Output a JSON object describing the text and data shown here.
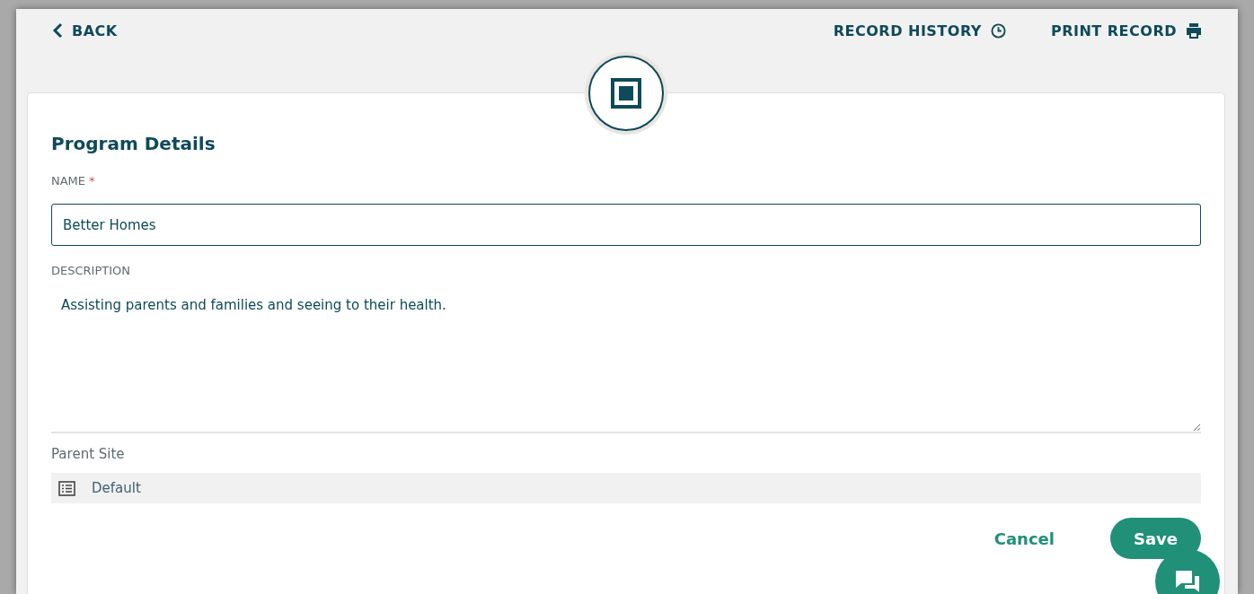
{
  "header": {
    "back": "BACK",
    "actions": [
      {
        "label": "RECORD HISTORY",
        "kind": "history"
      },
      {
        "label": "PRINT RECORD",
        "kind": "print"
      }
    ]
  },
  "form": {
    "title": "Program Details",
    "name": {
      "label": "NAME",
      "required_mark": "*",
      "value": "Better Homes"
    },
    "description": {
      "label": "DESCRIPTION",
      "value": "Assisting parents and families and seeing to their health."
    },
    "parent_site": {
      "label": "Parent Site",
      "value": "Default"
    },
    "buttons": [
      {
        "label": "Cancel",
        "kind": "secondary"
      },
      {
        "label": "Save",
        "kind": "primary"
      }
    ]
  }
}
